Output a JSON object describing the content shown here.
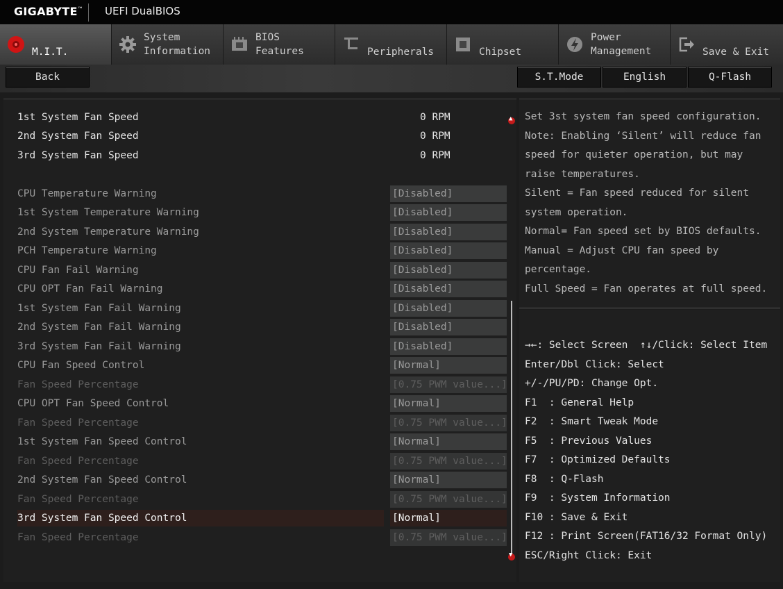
{
  "header": {
    "brand": "GIGABYTE",
    "brand_mark": "™",
    "product": "UEFI DualBIOS"
  },
  "tabs": [
    {
      "label": "M.I.T.",
      "icon": "mit-icon",
      "active": true,
      "lines": 1
    },
    {
      "label": "System\nInformation",
      "icon": "gear-icon",
      "active": false,
      "lines": 2
    },
    {
      "label": "BIOS\nFeatures",
      "icon": "chip-icon",
      "active": false,
      "lines": 2
    },
    {
      "label": "Peripherals",
      "icon": "peripherals-icon",
      "active": false,
      "lines": 1
    },
    {
      "label": "Chipset",
      "icon": "chipset-icon",
      "active": false,
      "lines": 1
    },
    {
      "label": "Power\nManagement",
      "icon": "power-icon",
      "active": false,
      "lines": 2
    },
    {
      "label": "Save & Exit",
      "icon": "exit-icon",
      "active": false,
      "lines": 1
    }
  ],
  "toolbar": {
    "back": "Back",
    "st_mode": "S.T.Mode",
    "language": "English",
    "qflash": "Q-Flash"
  },
  "settings": [
    {
      "label": "1st System Fan Speed",
      "value": "0 RPM",
      "kind": "info"
    },
    {
      "label": "2nd System Fan Speed",
      "value": "0 RPM",
      "kind": "info"
    },
    {
      "label": "3rd System Fan Speed",
      "value": "0 RPM",
      "kind": "info"
    },
    {
      "label": "CPU Temperature Warning",
      "value": "[Disabled]",
      "kind": "set"
    },
    {
      "label": "1st System Temperature Warning",
      "value": "[Disabled]",
      "kind": "set"
    },
    {
      "label": "2nd System Temperature Warning",
      "value": "[Disabled]",
      "kind": "set"
    },
    {
      "label": "PCH Temperature Warning",
      "value": "[Disabled]",
      "kind": "set"
    },
    {
      "label": "CPU Fan Fail Warning",
      "value": "[Disabled]",
      "kind": "set"
    },
    {
      "label": "CPU OPT Fan Fail Warning",
      "value": "[Disabled]",
      "kind": "set"
    },
    {
      "label": "1st System Fan Fail Warning",
      "value": "[Disabled]",
      "kind": "set"
    },
    {
      "label": "2nd System Fan Fail Warning",
      "value": "[Disabled]",
      "kind": "set"
    },
    {
      "label": "3rd System Fan Fail Warning",
      "value": "[Disabled]",
      "kind": "set"
    },
    {
      "label": "CPU Fan Speed Control",
      "value": "[Normal]",
      "kind": "set"
    },
    {
      "label": "Fan Speed Percentage",
      "value": "[0.75 PWM value...]",
      "kind": "dim"
    },
    {
      "label": "CPU OPT Fan Speed Control",
      "value": "[Normal]",
      "kind": "set"
    },
    {
      "label": "Fan Speed Percentage",
      "value": "[0.75 PWM value...]",
      "kind": "dim"
    },
    {
      "label": "1st System Fan Speed Control",
      "value": "[Normal]",
      "kind": "set"
    },
    {
      "label": "Fan Speed Percentage",
      "value": "[0.75 PWM value...]",
      "kind": "dim"
    },
    {
      "label": "2nd System Fan Speed Control",
      "value": "[Normal]",
      "kind": "set"
    },
    {
      "label": "Fan Speed Percentage",
      "value": "[0.75 PWM value...]",
      "kind": "dim"
    },
    {
      "label": "3rd System Fan Speed Control",
      "value": "[Normal]",
      "kind": "sel"
    },
    {
      "label": "Fan Speed Percentage",
      "value": "[0.75 PWM value...]",
      "kind": "dim"
    }
  ],
  "help": [
    "Set 3st system fan speed configuration.",
    "Note: Enabling ‘Silent’ will reduce fan",
    "speed for quieter operation, but may",
    "raise temperatures.",
    "Silent = Fan speed reduced for silent",
    "system operation.",
    "Normal= Fan speed set by BIOS defaults.",
    "Manual = Adjust CPU fan speed by",
    "percentage.",
    "Full Speed = Fan operates at full speed."
  ],
  "keys": [
    "→←: Select Screen  ↑↓/Click: Select Item",
    "Enter/Dbl Click: Select",
    "+/-/PU/PD: Change Opt.",
    "F1  : General Help",
    "F2  : Smart Tweak Mode",
    "F5  : Previous Values",
    "F7  : Optimized Defaults",
    "F8  : Q-Flash",
    "F9  : System Information",
    "F10 : Save & Exit",
    "F12 : Print Screen(FAT16/32 Format Only)",
    "ESC/Right Click: Exit"
  ],
  "colors": {
    "accent": "#c41a1a",
    "selected_row": "#2e1f1c"
  }
}
